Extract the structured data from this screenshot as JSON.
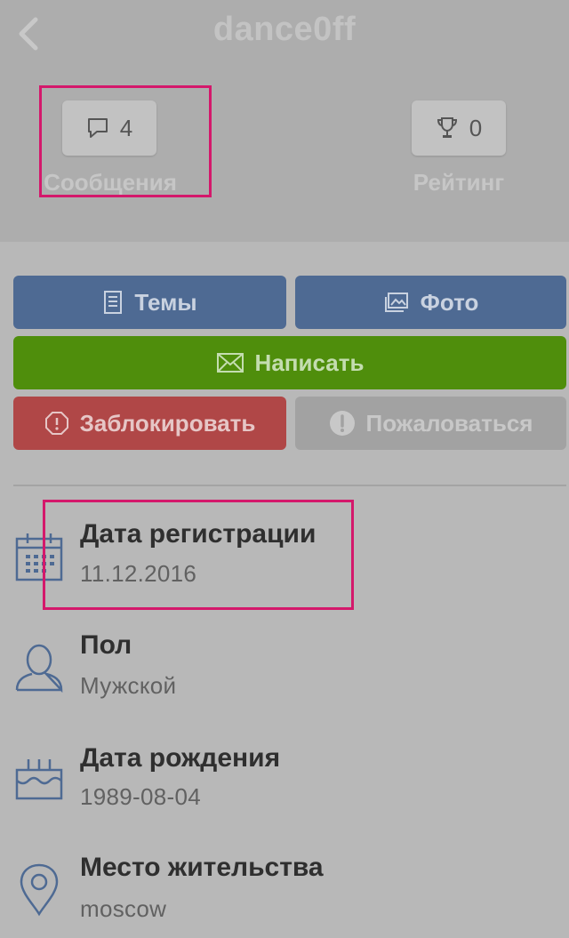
{
  "header": {
    "title": "dance0ff",
    "messages": {
      "count": "4",
      "label": "Сообщения"
    },
    "rating": {
      "count": "0",
      "label": "Рейтинг"
    }
  },
  "actions": {
    "topics": "Темы",
    "photo": "Фото",
    "write": "Написать",
    "block": "Заблокировать",
    "report": "Пожаловаться"
  },
  "info": [
    {
      "label": "Дата регистрации",
      "value": "11.12.2016",
      "icon": "calendar-icon"
    },
    {
      "label": "Пол",
      "value": "Мужской",
      "icon": "user-icon"
    },
    {
      "label": "Дата рождения",
      "value": "1989-08-04",
      "icon": "birthday-cake-icon"
    },
    {
      "label": "Место жительства",
      "value": "moscow",
      "icon": "location-pin-icon"
    }
  ],
  "colors": {
    "highlight": "#d4186b",
    "blue": "#4e6a93",
    "green": "#4f8e0c",
    "red": "#b04747",
    "gray": "#a2a2a2"
  }
}
